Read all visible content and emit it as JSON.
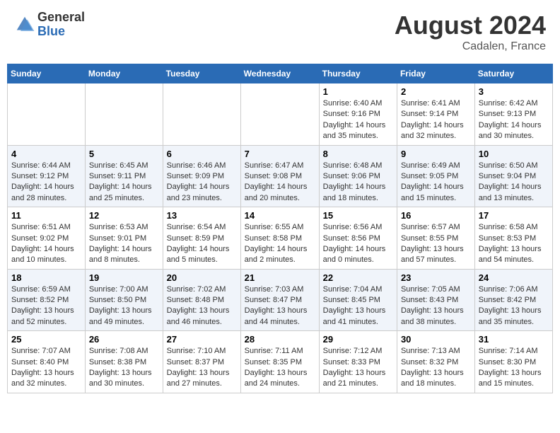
{
  "header": {
    "logo_general": "General",
    "logo_blue": "Blue",
    "month_year": "August 2024",
    "location": "Cadalen, France"
  },
  "weekdays": [
    "Sunday",
    "Monday",
    "Tuesday",
    "Wednesday",
    "Thursday",
    "Friday",
    "Saturday"
  ],
  "weeks": [
    [
      {
        "day": "",
        "info": ""
      },
      {
        "day": "",
        "info": ""
      },
      {
        "day": "",
        "info": ""
      },
      {
        "day": "",
        "info": ""
      },
      {
        "day": "1",
        "info": "Sunrise: 6:40 AM\nSunset: 9:16 PM\nDaylight: 14 hours and 35 minutes."
      },
      {
        "day": "2",
        "info": "Sunrise: 6:41 AM\nSunset: 9:14 PM\nDaylight: 14 hours and 32 minutes."
      },
      {
        "day": "3",
        "info": "Sunrise: 6:42 AM\nSunset: 9:13 PM\nDaylight: 14 hours and 30 minutes."
      }
    ],
    [
      {
        "day": "4",
        "info": "Sunrise: 6:44 AM\nSunset: 9:12 PM\nDaylight: 14 hours and 28 minutes."
      },
      {
        "day": "5",
        "info": "Sunrise: 6:45 AM\nSunset: 9:11 PM\nDaylight: 14 hours and 25 minutes."
      },
      {
        "day": "6",
        "info": "Sunrise: 6:46 AM\nSunset: 9:09 PM\nDaylight: 14 hours and 23 minutes."
      },
      {
        "day": "7",
        "info": "Sunrise: 6:47 AM\nSunset: 9:08 PM\nDaylight: 14 hours and 20 minutes."
      },
      {
        "day": "8",
        "info": "Sunrise: 6:48 AM\nSunset: 9:06 PM\nDaylight: 14 hours and 18 minutes."
      },
      {
        "day": "9",
        "info": "Sunrise: 6:49 AM\nSunset: 9:05 PM\nDaylight: 14 hours and 15 minutes."
      },
      {
        "day": "10",
        "info": "Sunrise: 6:50 AM\nSunset: 9:04 PM\nDaylight: 14 hours and 13 minutes."
      }
    ],
    [
      {
        "day": "11",
        "info": "Sunrise: 6:51 AM\nSunset: 9:02 PM\nDaylight: 14 hours and 10 minutes."
      },
      {
        "day": "12",
        "info": "Sunrise: 6:53 AM\nSunset: 9:01 PM\nDaylight: 14 hours and 8 minutes."
      },
      {
        "day": "13",
        "info": "Sunrise: 6:54 AM\nSunset: 8:59 PM\nDaylight: 14 hours and 5 minutes."
      },
      {
        "day": "14",
        "info": "Sunrise: 6:55 AM\nSunset: 8:58 PM\nDaylight: 14 hours and 2 minutes."
      },
      {
        "day": "15",
        "info": "Sunrise: 6:56 AM\nSunset: 8:56 PM\nDaylight: 14 hours and 0 minutes."
      },
      {
        "day": "16",
        "info": "Sunrise: 6:57 AM\nSunset: 8:55 PM\nDaylight: 13 hours and 57 minutes."
      },
      {
        "day": "17",
        "info": "Sunrise: 6:58 AM\nSunset: 8:53 PM\nDaylight: 13 hours and 54 minutes."
      }
    ],
    [
      {
        "day": "18",
        "info": "Sunrise: 6:59 AM\nSunset: 8:52 PM\nDaylight: 13 hours and 52 minutes."
      },
      {
        "day": "19",
        "info": "Sunrise: 7:00 AM\nSunset: 8:50 PM\nDaylight: 13 hours and 49 minutes."
      },
      {
        "day": "20",
        "info": "Sunrise: 7:02 AM\nSunset: 8:48 PM\nDaylight: 13 hours and 46 minutes."
      },
      {
        "day": "21",
        "info": "Sunrise: 7:03 AM\nSunset: 8:47 PM\nDaylight: 13 hours and 44 minutes."
      },
      {
        "day": "22",
        "info": "Sunrise: 7:04 AM\nSunset: 8:45 PM\nDaylight: 13 hours and 41 minutes."
      },
      {
        "day": "23",
        "info": "Sunrise: 7:05 AM\nSunset: 8:43 PM\nDaylight: 13 hours and 38 minutes."
      },
      {
        "day": "24",
        "info": "Sunrise: 7:06 AM\nSunset: 8:42 PM\nDaylight: 13 hours and 35 minutes."
      }
    ],
    [
      {
        "day": "25",
        "info": "Sunrise: 7:07 AM\nSunset: 8:40 PM\nDaylight: 13 hours and 32 minutes."
      },
      {
        "day": "26",
        "info": "Sunrise: 7:08 AM\nSunset: 8:38 PM\nDaylight: 13 hours and 30 minutes."
      },
      {
        "day": "27",
        "info": "Sunrise: 7:10 AM\nSunset: 8:37 PM\nDaylight: 13 hours and 27 minutes."
      },
      {
        "day": "28",
        "info": "Sunrise: 7:11 AM\nSunset: 8:35 PM\nDaylight: 13 hours and 24 minutes."
      },
      {
        "day": "29",
        "info": "Sunrise: 7:12 AM\nSunset: 8:33 PM\nDaylight: 13 hours and 21 minutes."
      },
      {
        "day": "30",
        "info": "Sunrise: 7:13 AM\nSunset: 8:32 PM\nDaylight: 13 hours and 18 minutes."
      },
      {
        "day": "31",
        "info": "Sunrise: 7:14 AM\nSunset: 8:30 PM\nDaylight: 13 hours and 15 minutes."
      }
    ]
  ]
}
